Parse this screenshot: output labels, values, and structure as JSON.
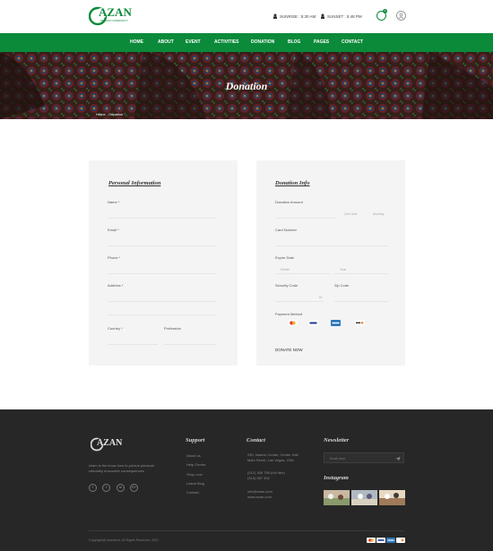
{
  "header": {
    "logo_text": "AZAN",
    "logo_sub": "MUSLIM COMMUNITY",
    "sunrise": "SUNRISE : 5:30 AM",
    "sunset": "SUNSET : 5:48 PM",
    "cart_count": "0"
  },
  "nav": {
    "items": [
      "HOME",
      "ABOUT",
      "EVENT",
      "ACTIVITIES",
      "DONATION",
      "BLOG",
      "PAGES",
      "CONTACT"
    ]
  },
  "banner": {
    "title": "Donation",
    "breadcrumb": "Home - Donation"
  },
  "personal": {
    "title": "Personal Information",
    "name_label": "Name *",
    "email_label": "Email *",
    "phone_label": "Phone *",
    "address_label": "Address *",
    "country_label": "Country *",
    "profession_label": "Profession"
  },
  "donation": {
    "title": "Donation Info",
    "amount_label": "Donation Amount",
    "one_time": "One time",
    "monthly": "Monthly",
    "card_label": "Card Number",
    "expire_label": "Expire Date",
    "month_ph": "Month",
    "year_ph": "Year",
    "security_label": "Security Code",
    "security_hint": "ID",
    "zip_label": "Zip Code",
    "payment_label": "Payment Method",
    "payment_methods": [
      "mastercard-icon",
      "visa-icon",
      "amex-icon",
      "discover-icon"
    ],
    "donate_button": "DONATE NOW"
  },
  "footer": {
    "logo_text": "AZAN",
    "description": "Islam is the know how to pursue pleasure rationally encounter consequences",
    "social": [
      "f",
      "t",
      "in",
      "G+"
    ],
    "support_title": "Support",
    "support_links": [
      "About us",
      "Help Centre",
      "Shop now",
      "Latest Blog",
      "Contact"
    ],
    "contact_title": "Contact",
    "address_line1": "250, Islamic Center, Center Hall",
    "address_line2": "Main Street, Las Vegas, USA",
    "phone1": "(012) 306 785 (toll free)",
    "phone2": "(415) 587 452",
    "email": "info@azan.com",
    "website": "www.azan.com",
    "newsletter_title": "Newsletter",
    "newsletter_ph": "Email here",
    "instagram_title": "Instagram",
    "copyright": "Copyright@ Azantech. All Rights Reserved. 2021"
  },
  "colors": {
    "brand": "#0b8a3a",
    "footer_bg": "#272727",
    "card_bg": "#f4f4f4"
  }
}
